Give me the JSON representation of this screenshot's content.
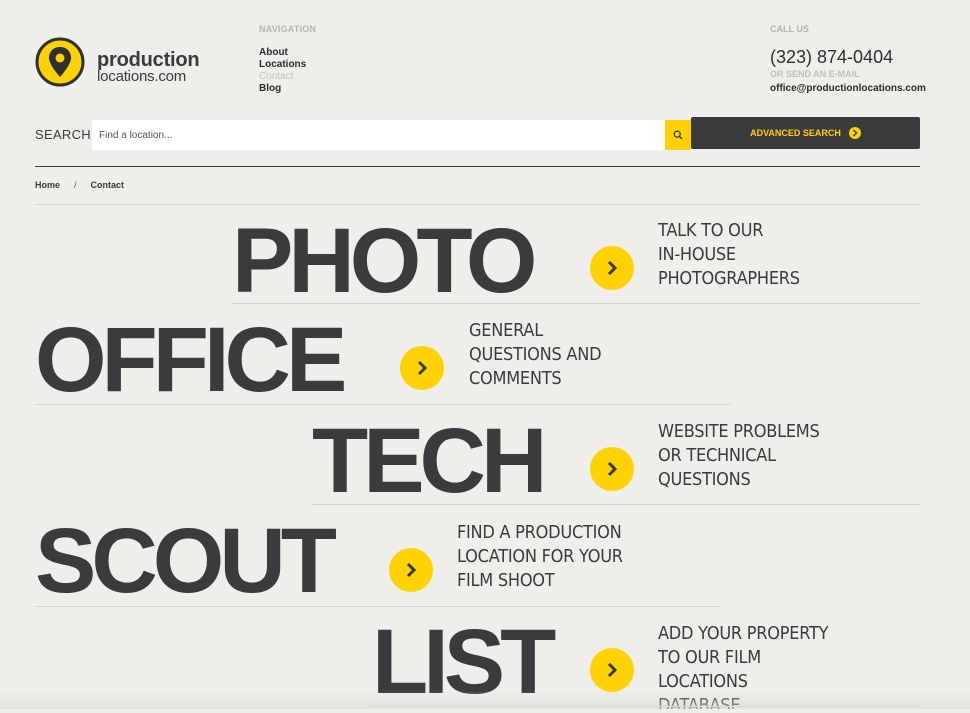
{
  "logo": {
    "line1": "production",
    "line2": "locations.com"
  },
  "navigation": {
    "heading": "NAVIGATION",
    "items": [
      {
        "label": "About",
        "active": false
      },
      {
        "label": "Locations",
        "active": false
      },
      {
        "label": "Contact",
        "active": true
      },
      {
        "label": "Blog",
        "active": false
      }
    ]
  },
  "call": {
    "heading": "CALL US",
    "phone": "(323) 874-0404",
    "email_heading": "OR SEND AN E-MAIL",
    "email": "office@productionlocations.com"
  },
  "search": {
    "label": "SEARCH:",
    "placeholder": "Find a location...",
    "value": "",
    "advanced_label": "ADVANCED SEARCH"
  },
  "breadcrumb": {
    "home": "Home",
    "separator": "/",
    "current": "Contact"
  },
  "contacts": [
    {
      "title": "PHOTO",
      "desc": [
        "TALK TO OUR",
        "IN-HOUSE",
        "PHOTOGRAPHERS"
      ]
    },
    {
      "title": "OFFICE",
      "desc": [
        "GENERAL",
        "QUESTIONS AND",
        "COMMENTS"
      ]
    },
    {
      "title": "TECH",
      "desc": [
        "WEBSITE PROBLEMS",
        "OR TECHNICAL",
        "QUESTIONS"
      ]
    },
    {
      "title": "SCOUT",
      "desc": [
        "FIND A PRODUCTION",
        "LOCATION FOR YOUR",
        "FILM SHOOT"
      ]
    },
    {
      "title": "LIST",
      "desc": [
        "ADD YOUR PROPERTY",
        "TO OUR FILM",
        "LOCATIONS",
        "DATABASE"
      ]
    }
  ],
  "colors": {
    "accent": "#ffd200",
    "text": "#3a3b3d",
    "background": "#efeeea"
  }
}
